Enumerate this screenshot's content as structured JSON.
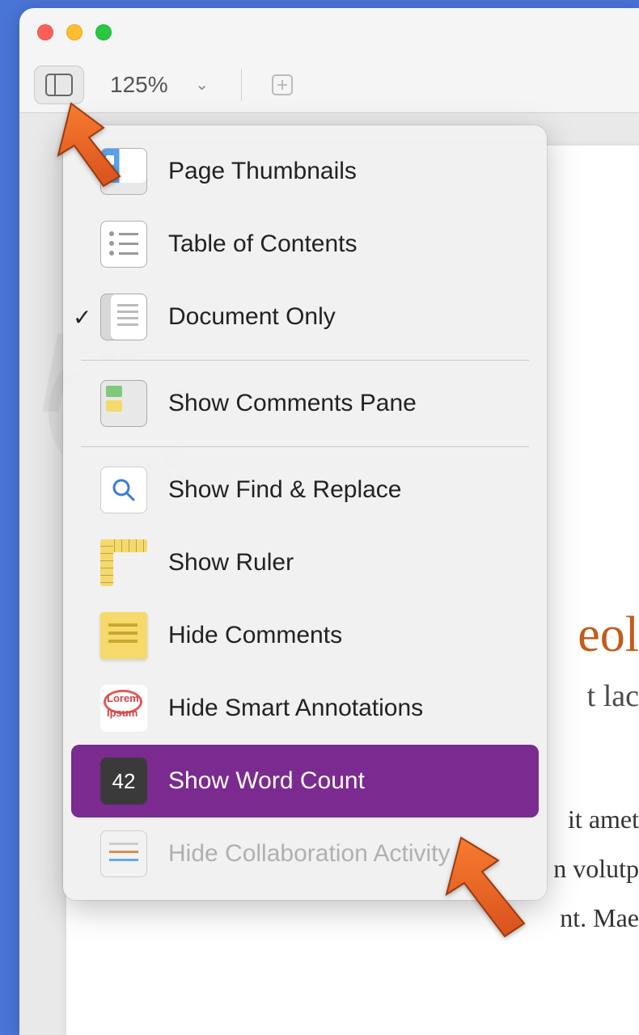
{
  "toolbar": {
    "zoom_label": "125%"
  },
  "menu": {
    "items": [
      {
        "label": "Page Thumbnails"
      },
      {
        "label": "Table of Contents"
      },
      {
        "label": "Document Only",
        "checked": true
      },
      {
        "label": "Show Comments Pane"
      },
      {
        "label": "Show Find & Replace"
      },
      {
        "label": "Show Ruler"
      },
      {
        "label": "Hide Comments"
      },
      {
        "label": "Hide Smart Annotations"
      },
      {
        "label": "Show Word Count",
        "highlighted": true,
        "icon_text": "42"
      },
      {
        "label": "Hide Collaboration Activity",
        "disabled": true
      }
    ]
  },
  "document": {
    "title_fragment": "eol",
    "subtitle_fragment": "t lac",
    "body_lines": [
      "it amet",
      "n volutp",
      "nt. Mae"
    ]
  },
  "watermark": {
    "line1": "PC",
    "line2": "risk.com"
  },
  "annotations": {
    "lorem": "Lorem",
    "ipsum": "Ipsum"
  }
}
